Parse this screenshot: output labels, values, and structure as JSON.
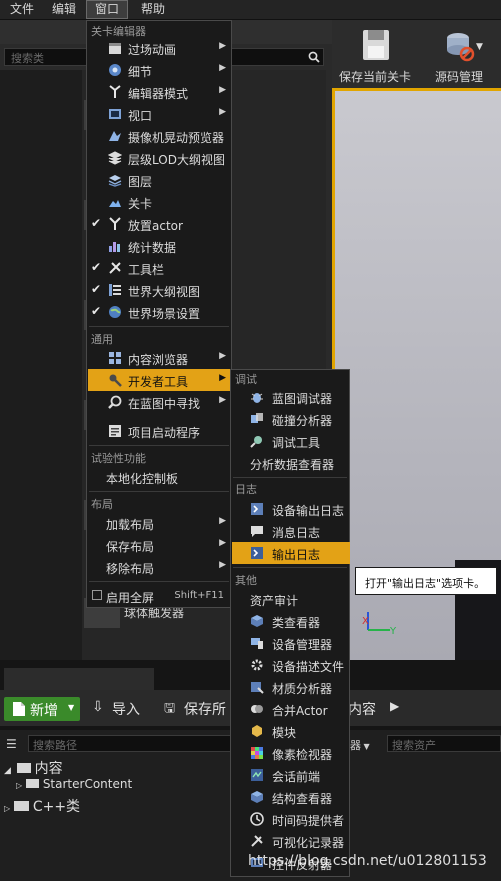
{
  "menubar": {
    "file": "文件",
    "edit": "编辑",
    "window": "窗口",
    "help": "帮助"
  },
  "left_panel": {
    "search_placeholder": "搜索类",
    "last_item": "球体触发器"
  },
  "toolbar": {
    "save_level": "保存当前关卡",
    "source_control": "源码管理"
  },
  "window_menu": {
    "section_level_editor": "关卡编辑器",
    "items_level_editor": [
      {
        "label": "过场动画",
        "checked": false,
        "submenu": true,
        "icon": "clapper-icon"
      },
      {
        "label": "细节",
        "checked": false,
        "submenu": true,
        "icon": "details-icon"
      },
      {
        "label": "编辑器模式",
        "checked": false,
        "submenu": true,
        "icon": "modes-icon"
      },
      {
        "label": "视口",
        "checked": false,
        "submenu": true,
        "icon": "viewport-icon"
      },
      {
        "label": "摄像机晃动预览器",
        "checked": false,
        "submenu": false,
        "icon": "camera-shake-icon"
      },
      {
        "label": "层级LOD大纲视图",
        "checked": false,
        "submenu": false,
        "icon": "hlod-icon"
      },
      {
        "label": "图层",
        "checked": false,
        "submenu": false,
        "icon": "layers-icon"
      },
      {
        "label": "关卡",
        "checked": false,
        "submenu": false,
        "icon": "levels-icon"
      },
      {
        "label": "放置actor",
        "checked": true,
        "submenu": false,
        "icon": "place-actor-icon"
      },
      {
        "label": "统计数据",
        "checked": false,
        "submenu": false,
        "icon": "stats-icon"
      },
      {
        "label": "工具栏",
        "checked": true,
        "submenu": false,
        "icon": "toolbar-icon"
      },
      {
        "label": "世界大纲视图",
        "checked": true,
        "submenu": false,
        "icon": "outliner-icon"
      },
      {
        "label": "世界场景设置",
        "checked": true,
        "submenu": false,
        "icon": "world-settings-icon"
      }
    ],
    "section_general": "通用",
    "items_general": [
      {
        "label": "内容浏览器",
        "submenu": true,
        "icon": "content-browser-icon"
      },
      {
        "label": "开发者工具",
        "submenu": true,
        "icon": "developer-tools-icon"
      },
      {
        "label": "在蓝图中寻找",
        "submenu": true,
        "icon": "find-in-blueprints-icon"
      },
      {
        "label": "项目启动程序",
        "submenu": false,
        "icon": "project-launcher-icon"
      }
    ],
    "section_experimental": "试验性功能",
    "item_localization": "本地化控制板",
    "section_layout": "布局",
    "items_layout": [
      {
        "label": "加载布局",
        "submenu": true
      },
      {
        "label": "保存布局",
        "submenu": true
      },
      {
        "label": "移除布局",
        "submenu": true
      }
    ],
    "fullscreen_label": "启用全屏",
    "fullscreen_shortcut": "Shift+F11"
  },
  "developer_tools_menu": {
    "section_debug": "调试",
    "items_debug": [
      {
        "label": "蓝图调试器",
        "icon": "blueprint-debugger-icon"
      },
      {
        "label": "碰撞分析器",
        "icon": "collision-analyzer-icon"
      },
      {
        "label": "调试工具",
        "icon": "debug-tools-icon"
      },
      {
        "label": "分析数据查看器",
        "icon": ""
      }
    ],
    "section_log": "日志",
    "items_log": [
      {
        "label": "设备输出日志",
        "icon": "device-output-log-icon"
      },
      {
        "label": "消息日志",
        "icon": "message-log-icon"
      },
      {
        "label": "输出日志",
        "icon": "output-log-icon"
      }
    ],
    "section_misc": "其他",
    "items_misc": [
      {
        "label": "资产审计",
        "icon": ""
      },
      {
        "label": "类查看器",
        "icon": "class-viewer-icon"
      },
      {
        "label": "设备管理器",
        "icon": "device-manager-icon"
      },
      {
        "label": "设备描述文件",
        "icon": "device-profiles-icon"
      },
      {
        "label": "材质分析器",
        "icon": "material-analyzer-icon"
      },
      {
        "label": "合并Actor",
        "icon": "merge-actors-icon"
      },
      {
        "label": "模块",
        "icon": "modules-icon"
      },
      {
        "label": "像素检视器",
        "icon": "pixel-inspector-icon"
      },
      {
        "label": "会话前端",
        "icon": "session-frontend-icon"
      },
      {
        "label": "结构查看器",
        "icon": "struct-viewer-icon"
      },
      {
        "label": "时间码提供者",
        "icon": "timecode-icon"
      },
      {
        "label": "可视化记录器",
        "icon": "visual-logger-icon"
      },
      {
        "label": "控件反射器",
        "icon": "widget-reflector-icon"
      }
    ]
  },
  "tooltip": "打开\"输出日志\"选项卡。",
  "content_browser": {
    "new_button": "新增",
    "import_button": "导入",
    "save_all_button": "保存所",
    "content_label": "内容",
    "path_search_placeholder": "搜索路径",
    "filters_label": "器",
    "asset_search_placeholder": "搜索资产",
    "tree": [
      "内容",
      "StarterContent",
      "C++类"
    ]
  },
  "watermark": "https://blog.csdn.net/u012801153",
  "colors": {
    "highlight": "#e3a216",
    "new_button": "#3a8a2a",
    "menu_bg": "#1a1a1a"
  }
}
